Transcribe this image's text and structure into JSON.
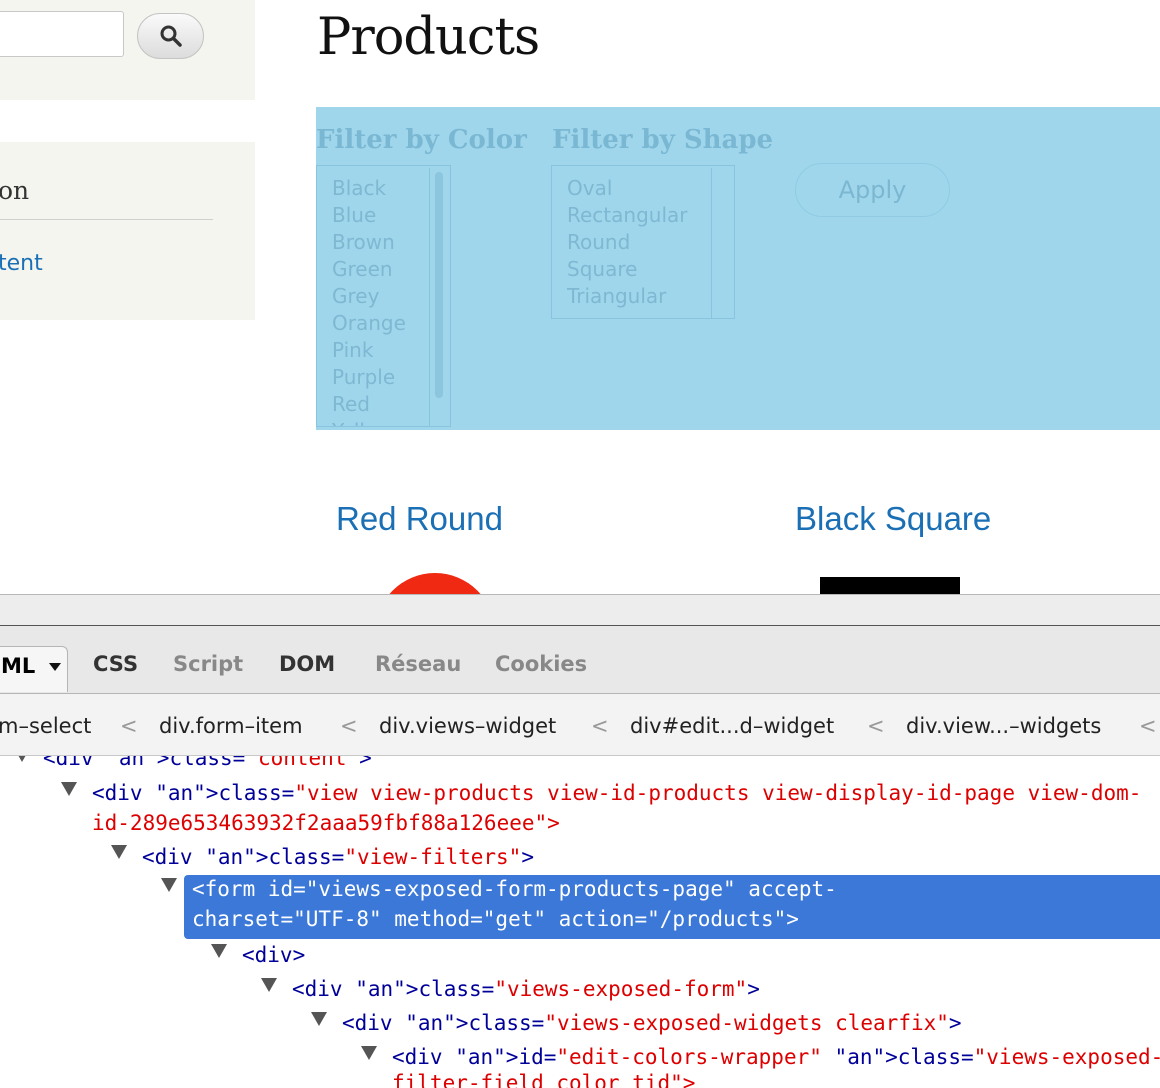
{
  "page": {
    "title": "Products",
    "sidebar": {
      "block_title": "on",
      "link": "tent"
    },
    "filters": {
      "color": {
        "label": "Filter by Color",
        "options": [
          "Black",
          "Blue",
          "Brown",
          "Green",
          "Grey",
          "Orange",
          "Pink",
          "Purple",
          "Red",
          "Yellow"
        ]
      },
      "shape": {
        "label": "Filter by Shape",
        "options": [
          "Oval",
          "Rectangular",
          "Round",
          "Square",
          "Triangular"
        ]
      },
      "apply_label": "Apply"
    },
    "products": [
      {
        "name": "Red Round",
        "color": "#f02a12"
      },
      {
        "name": "Black Square",
        "color": "#000000"
      }
    ]
  },
  "devtools": {
    "tabs": [
      "ML",
      "CSS",
      "Script",
      "DOM",
      "Réseau",
      "Cookies"
    ],
    "breadcrumb": [
      "m–select",
      "div.form–item",
      "div.views–widget",
      "div#edit...d–widget",
      "div.view...–widgets"
    ],
    "breadcrumb_sep": "<",
    "tree": [
      "<div class=\"content\">",
      "<div class=\"view view-products view-id-products view-display-id-page view-dom-",
      "id-289e653463932f2aaa59fbf88a126eee\">",
      "<div class=\"view-filters\">",
      "<form id=\"views-exposed-form-products-page\" accept-",
      "charset=\"UTF-8\" method=\"get\" action=\"/products\">",
      "<div>",
      "<div class=\"views-exposed-form\">",
      "<div class=\"views-exposed-widgets clearfix\">",
      "<div id=\"edit-colors-wrapper\" class=\"views-exposed-widget v",
      "filter-field_color_tid\">"
    ],
    "highlight_color": "#3b78d7"
  }
}
